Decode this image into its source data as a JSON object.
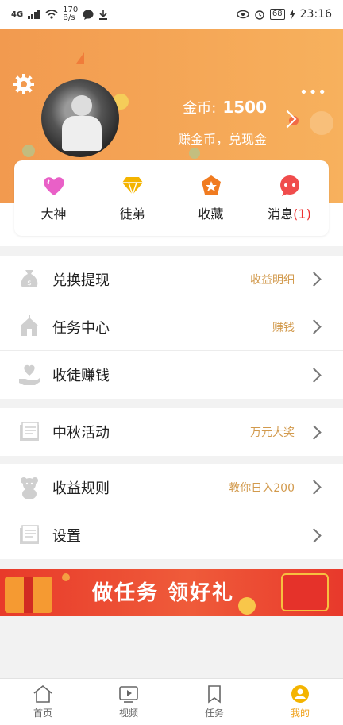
{
  "status": {
    "network": "4G",
    "speed_value": "170",
    "speed_unit": "B/s",
    "battery": "68",
    "time": "23:16"
  },
  "header": {
    "coins_label": "金币:",
    "coins_value": "1500",
    "earn_text": "赚金币，兑现金"
  },
  "quick": [
    {
      "label": "大神",
      "icon": "heart-icon",
      "color": "#e960c7"
    },
    {
      "label": "徒弟",
      "icon": "diamond-icon",
      "color": "#f4b400"
    },
    {
      "label": "收藏",
      "icon": "star-icon",
      "color": "#f07b20"
    },
    {
      "label": "消息",
      "count": "(1)",
      "icon": "chat-icon",
      "color": "#f04c4c"
    }
  ],
  "group1": [
    {
      "label": "兑换提现",
      "hint": "收益明细",
      "icon": "money-bag-icon"
    },
    {
      "label": "任务中心",
      "hint": "赚钱",
      "icon": "tent-icon"
    },
    {
      "label": "收徒赚钱",
      "hint": "",
      "icon": "hand-heart-icon"
    }
  ],
  "group2": [
    {
      "label": "中秋活动",
      "hint": "万元大奖",
      "icon": "document-icon"
    }
  ],
  "group3": [
    {
      "label": "收益规则",
      "hint": "教你日入200",
      "icon": "bear-icon"
    },
    {
      "label": "设置",
      "hint": "",
      "icon": "document-icon"
    }
  ],
  "banner": {
    "text": "做任务 领好礼"
  },
  "tabs": [
    {
      "label": "首页",
      "icon": "home-icon"
    },
    {
      "label": "视频",
      "icon": "video-icon"
    },
    {
      "label": "任务",
      "icon": "bookmark-icon"
    },
    {
      "label": "我的",
      "icon": "profile-icon"
    }
  ],
  "colors": {
    "accent": "#f29a4f",
    "hint": "#d29a4d",
    "active_tab": "#f0a21a",
    "banner": "#e83a2a"
  }
}
